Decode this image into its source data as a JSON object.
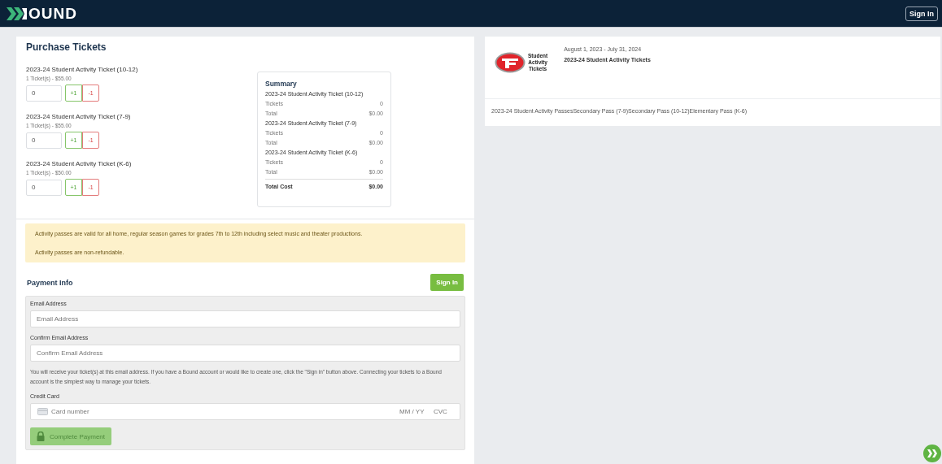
{
  "header": {
    "logo_text": "OUND",
    "sign_in": "Sign In"
  },
  "purchase": {
    "title": "Purchase Tickets",
    "tickets": [
      {
        "name": "2023-24 Student Activity Ticket (10-12)",
        "price": "1 Ticket(s) - $55.00",
        "quantity": "0",
        "plus": "+1",
        "minus": "-1"
      },
      {
        "name": "2023-24 Student Activity Ticket (7-9)",
        "price": "1 Ticket(s) - $55.00",
        "quantity": "0",
        "plus": "+1",
        "minus": "-1"
      },
      {
        "name": "2023-24 Student Activity Ticket (K-6)",
        "price": "1 Ticket(s) - $50.00",
        "quantity": "0",
        "plus": "+1",
        "minus": "-1"
      }
    ],
    "summary": {
      "title": "Summary",
      "groups": [
        {
          "name": "2023-24 Student Activity Ticket (10-12)",
          "rows": [
            {
              "label": "Tickets",
              "value": "0"
            },
            {
              "label": "Total",
              "value": "$0.00"
            }
          ]
        },
        {
          "name": "2023-24 Student Activity Ticket (7-9)",
          "rows": [
            {
              "label": "Tickets",
              "value": "0"
            },
            {
              "label": "Total",
              "value": "$0.00"
            }
          ]
        },
        {
          "name": "2023-24 Student Activity Ticket (K-6)",
          "rows": [
            {
              "label": "Tickets",
              "value": "0"
            },
            {
              "label": "Total",
              "value": "$0.00"
            }
          ]
        }
      ],
      "total_label": "Total Cost",
      "total_value": "$0.00"
    }
  },
  "notice": [
    "Activity passes are valid for all home, regular season games for grades 7th to 12th including select music and theater productions.",
    "Activity passes are non-refundable."
  ],
  "payment": {
    "title": "Payment Info",
    "sign_in": "Sign In",
    "fields": [
      {
        "label": "Email Address",
        "placeholder": "Email Address"
      },
      {
        "label": "Confirm Email Address",
        "placeholder": "Confirm Email Address"
      }
    ],
    "note": "You will receive your ticket(s) at this email address. If you have a Bound account or would like to create one, click the \"Sign in\" button above. Connecting your tickets to a Bound account is the simplest way to manage your tickets.",
    "card_label": "Credit Card",
    "card_placeholder": "Card number",
    "expiry_placeholder": "MM / YY",
    "cvc_placeholder": "CVC",
    "submit": {
      "label": "Complete Payment",
      "disabled": true
    }
  },
  "event": {
    "logo_lines": [
      "Student",
      "Activity",
      "Tickets"
    ],
    "dates": "August 1, 2023 - July 31, 2024",
    "title": "2023-24 Student Activity Tickets",
    "description": "2023-24 Student Activity PassesSecondary Pass (7-9)Secondary Pass (10-12)Elementary Pass (K-6)"
  }
}
